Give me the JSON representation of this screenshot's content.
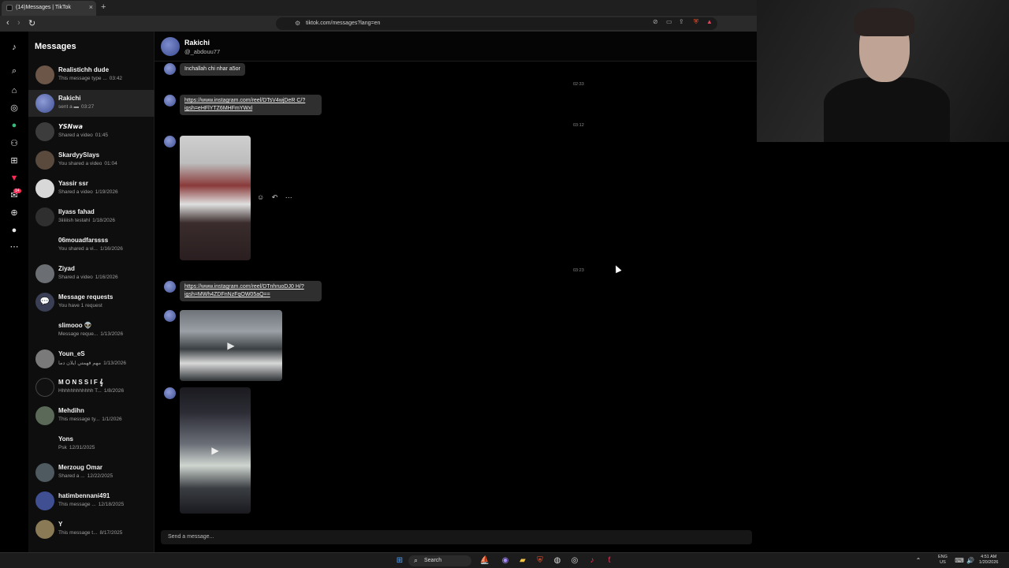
{
  "browser": {
    "tab_title": "(14)Messages | TikTok",
    "tab_close": "×",
    "new_tab": "+",
    "back": "‹",
    "forward": "›",
    "reload": "↻",
    "url": "tiktok.com/messages?lang=en"
  },
  "rail": {
    "notification_badge": "14"
  },
  "conversations": {
    "title": "Messages",
    "items": [
      {
        "name": "Realistichh dude",
        "preview": "This message type ...",
        "date": "03:42"
      },
      {
        "name": "Rakichi",
        "preview": "sent a ▬",
        "date": "03:27"
      },
      {
        "name": "𝙔𝙎𝙉𝙬𝙖",
        "preview": "Shared a video",
        "date": "01:45"
      },
      {
        "name": "SkardyySlays",
        "preview": "You shared a video",
        "date": "01:04"
      },
      {
        "name": "Yassir ssr",
        "preview": "Shared a video",
        "date": "1/19/2026"
      },
      {
        "name": "Ilyass fahad",
        "preview": "3iiiiiish testahl",
        "date": "1/18/2026"
      },
      {
        "name": "06mouadfarssss",
        "preview": "You shared a vi...",
        "date": "1/16/2026"
      },
      {
        "name": "Ziyad",
        "preview": "Shared a video",
        "date": "1/16/2026"
      },
      {
        "name": "Message requests",
        "preview": "You have 1 request",
        "date": ""
      },
      {
        "name": "slimooo 👽",
        "preview": "Message reque...",
        "date": "1/13/2026"
      },
      {
        "name": "Youn_eS",
        "preview": "مهم فهمتي ايلان دما",
        "date": "1/13/2026"
      },
      {
        "name": "M O N S S I F 𝄞",
        "preview": "Hhhhhhhhhhhh T...",
        "date": "1/8/2026"
      },
      {
        "name": "Mehdihn",
        "preview": "This message ty...",
        "date": "1/1/2026"
      },
      {
        "name": "Yons",
        "preview": "Psk",
        "date": "12/31/2025"
      },
      {
        "name": "Merzoug Omar",
        "preview": "Shared a ...",
        "date": "12/22/2025"
      },
      {
        "name": "hatimbennani491",
        "preview": "This message ...",
        "date": "12/18/2025"
      },
      {
        "name": "Y",
        "preview": "This message t...",
        "date": "8/17/2025"
      }
    ]
  },
  "chat": {
    "contact_name": "Rakichi",
    "contact_handle": "@_abdouu77",
    "messages": {
      "m1": "Inchallah chi nhar a5or",
      "t1": "02:33",
      "m2": "https://www.instagram.com/reel/DTsV4wjDeR C/?igsh=eHFlYTZ6MHFmYWxl",
      "t2": "03:12",
      "t3": "03:23",
      "m3": "https://www.instagram.com/reel/DTnhruoDJ0 H/?igsh=MWh4ZDFnNzFqOW05aQ=="
    },
    "actions": {
      "react": "☺",
      "reply": "↶",
      "more": "⋯"
    },
    "compose_placeholder": "Send a message..."
  },
  "taskbar": {
    "search_label": "Search",
    "lang_top": "ENG",
    "lang_bottom": "US",
    "time": "4:51 AM",
    "date": "1/20/2026"
  },
  "colors": {
    "accent": "#fe2c55",
    "bubble": "#2f2f2f",
    "panel": "#0e0e0e"
  }
}
